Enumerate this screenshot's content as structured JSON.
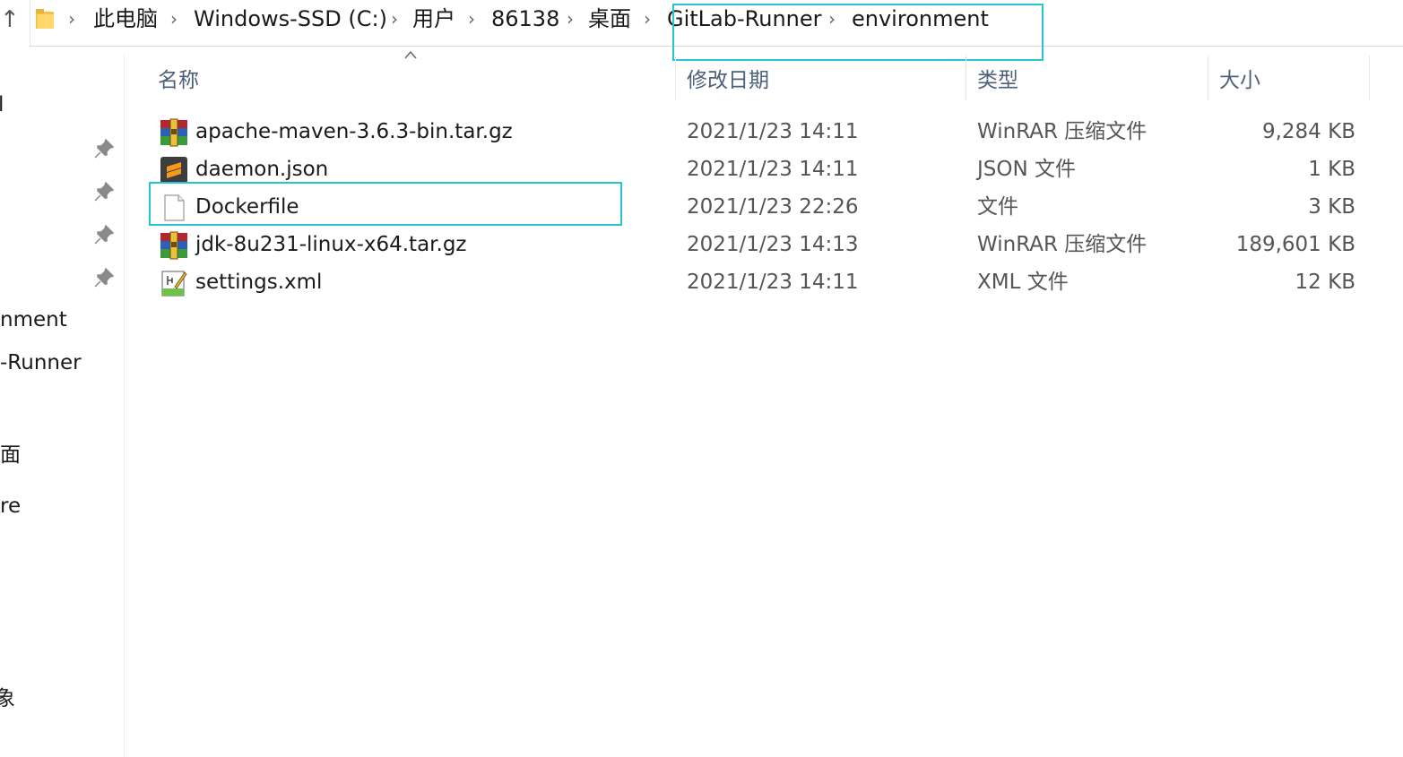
{
  "breadcrumb": [
    "此电脑",
    "Windows-SSD (C:)",
    "用户",
    "86138",
    "桌面",
    "GitLab-Runner",
    "environment"
  ],
  "columns": {
    "name": "名称",
    "date": "修改日期",
    "type": "类型",
    "size": "大小"
  },
  "files": [
    {
      "name": "apache-maven-3.6.3-bin.tar.gz",
      "date": "2021/1/23 14:11",
      "type": "WinRAR 压缩文件",
      "size": "9,284 KB",
      "icon": "winrar-archive-icon"
    },
    {
      "name": "daemon.json",
      "date": "2021/1/23 14:11",
      "type": "JSON 文件",
      "size": "1 KB",
      "icon": "sublime-text-icon"
    },
    {
      "name": "Dockerfile",
      "date": "2021/1/23 22:26",
      "type": "文件",
      "size": "3 KB",
      "icon": "blank-file-icon"
    },
    {
      "name": "jdk-8u231-linux-x64.tar.gz",
      "date": "2021/1/23 14:13",
      "type": "WinRAR 压缩文件",
      "size": "189,601 KB",
      "icon": "winrar-archive-icon"
    },
    {
      "name": "settings.xml",
      "date": "2021/1/23 14:11",
      "type": "XML 文件",
      "size": "12 KB",
      "icon": "xml-notepad-icon"
    }
  ],
  "nav": [
    "l",
    "nment",
    "-Runner",
    "面",
    "re",
    "象"
  ],
  "colors": {
    "highlight_box": "#26c6d0",
    "column_header": "#4c607a"
  }
}
